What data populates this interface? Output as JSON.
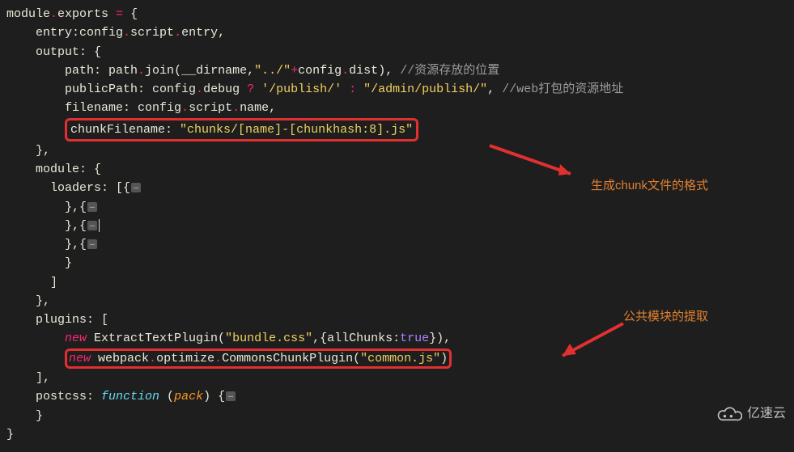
{
  "code": {
    "l1": {
      "a": "module",
      "b": ".",
      "c": "exports",
      "d": " = {"
    },
    "l2": {
      "a": "    entry:config",
      "b": ".",
      "c": "script",
      "d": ".",
      "e": "entry",
      "f": ","
    },
    "l3": {
      "a": "    output: {"
    },
    "l4": {
      "a": "        path: path",
      "b": ".",
      "c": "join",
      "d": "(",
      "e": "__dirname",
      "f": ",",
      "g": "\"../\"",
      "h": "+",
      "i": "config",
      "j": ".",
      "k": "dist",
      "l": "), ",
      "m": "//资源存放的位置"
    },
    "l5": {
      "a": "        publicPath: config",
      "b": ".",
      "c": "debug",
      "d": " ? ",
      "e": "'/publish/'",
      "f": " : ",
      "g": "\"/admin/publish/\"",
      "h": ", ",
      "i": "//web打包的资源地址"
    },
    "l6": {
      "a": "        filename: config",
      "b": ".",
      "c": "script",
      "d": ".",
      "e": "name",
      "f": ","
    },
    "l7": {
      "a": "chunkFilename: ",
      "b": "\"chunks/[name]-[chunkhash:8].js\""
    },
    "l8": {
      "a": "    },"
    },
    "l9": {
      "a": "    module: {"
    },
    "l10": {
      "a": "      loaders: [{"
    },
    "l11": {
      "a": "        },{"
    },
    "l12": {
      "a": "        },{"
    },
    "l13": {
      "a": "        },{"
    },
    "l14": {
      "a": "        }"
    },
    "l15": {
      "a": "      ]"
    },
    "l16": {
      "a": "    },"
    },
    "l17": {
      "a": "    plugins: ["
    },
    "l18": {
      "a": "        ",
      "b": "new",
      "c": " ExtractTextPlugin(",
      "d": "\"bundle.css\"",
      "e": ",{allChunks:",
      "f": "true",
      "g": "}),"
    },
    "l19": {
      "a": "new",
      "b": " webpack",
      "c": ".",
      "d": "optimize",
      "e": ".",
      "f": "CommonsChunkPlugin(",
      "g": "\"common.js\"",
      "h": ")"
    },
    "l20": {
      "a": "    ],"
    },
    "l21": {
      "a": "    postcss: ",
      "b": "function",
      "c": " (",
      "d": "pack",
      "e": ") {"
    },
    "l22": {
      "a": "    }"
    },
    "l23": {
      "a": "}"
    }
  },
  "fold_label": "…",
  "annotations": {
    "a1": "生成chunk文件的格式",
    "a2": "公共模块的提取"
  },
  "logo_text": "亿速云"
}
